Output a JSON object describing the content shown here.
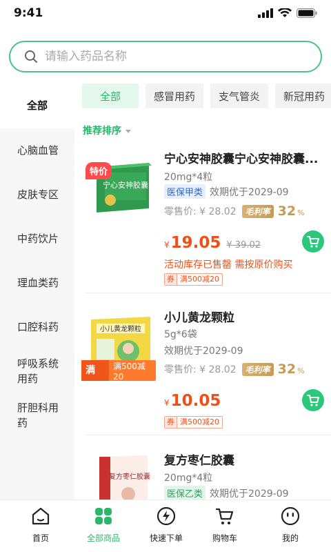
{
  "status": {
    "time": "9:41"
  },
  "search": {
    "placeholder": "请输入药品名称"
  },
  "sidebar": {
    "items": [
      {
        "label": "全部"
      },
      {
        "label": "心脑血管"
      },
      {
        "label": "皮肤专区"
      },
      {
        "label": "中药饮片"
      },
      {
        "label": "理血类药"
      },
      {
        "label": "口腔科药"
      },
      {
        "label": "呼吸系统用药"
      },
      {
        "label": "肝胆科用药"
      }
    ]
  },
  "chips": [
    {
      "label": "全部"
    },
    {
      "label": "感冒用药"
    },
    {
      "label": "支气管炎"
    },
    {
      "label": "新冠用药"
    }
  ],
  "sort": {
    "label": "推荐排序"
  },
  "products": [
    {
      "title": "宁心安神胶囊宁心安神胶囊...",
      "spec": "20mg*4粒",
      "insurance": "医保甲类",
      "expiry": "效期优于2029-09",
      "retail": "零售价: ¥ 28.02",
      "margin_label": "毛利率",
      "margin_value": "32",
      "margin_unit": "%",
      "price_symbol": "¥",
      "price": "19.05",
      "old_price": "¥ 39.02",
      "warning": "活动库存已售罄 需按原价购买",
      "coupon_key": "券",
      "coupon_value": "满500减20",
      "badge": "特价",
      "box_text": "宁心安神胶囊"
    },
    {
      "title": "小儿黄龙颗粒",
      "spec": "5g*6袋",
      "expiry": "效期优于2029-09",
      "retail": "零售价: ¥ 28.02",
      "margin_label": "毛利率",
      "margin_value": "32",
      "margin_unit": "%",
      "price_symbol": "¥",
      "price": "10.05",
      "coupon_key": "券",
      "coupon_value": "满500减20",
      "badge": "满减",
      "badge_sub": "满500减20",
      "box_text": "小儿黄龙颗粒"
    },
    {
      "title": "复方枣仁胶囊",
      "spec": "20mg*4粒",
      "insurance": "医保乙类",
      "expiry": "效期优于2029-09",
      "box_text": "复方枣仁胶囊"
    }
  ],
  "tabbar": [
    {
      "label": "首页"
    },
    {
      "label": "全部商品"
    },
    {
      "label": "快速下单"
    },
    {
      "label": "购物车"
    },
    {
      "label": "我的"
    }
  ],
  "colors": {
    "accent": "#29b86a",
    "price": "#f04f17",
    "margin": "#c69a54"
  }
}
